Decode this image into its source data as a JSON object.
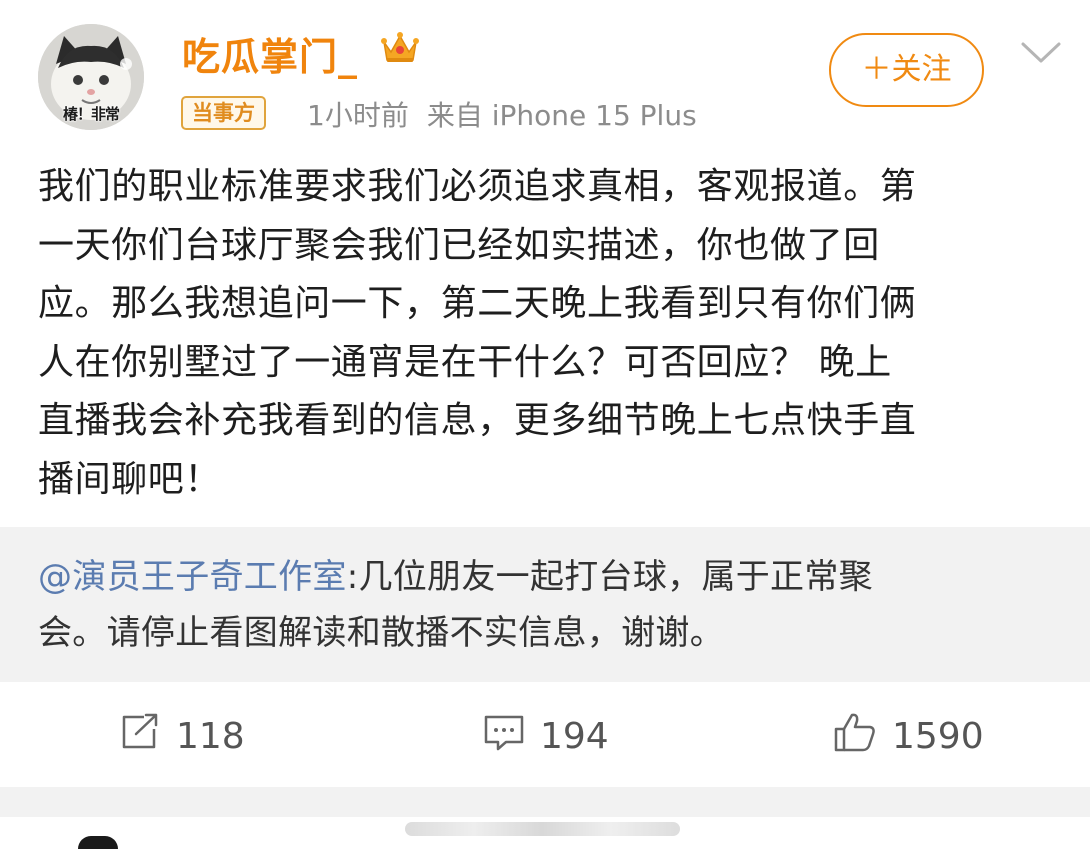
{
  "author": {
    "name": "吃瓜掌门_",
    "avatar_caption": "椿！非常",
    "badge": "当事方",
    "time": "1小时前",
    "source": "来自 iPhone 15 Plus",
    "verified_icon": "crown-icon"
  },
  "follow_button": "＋关注",
  "post": {
    "lines": [
      "我们的职业标准要求我们必须追求真相，客观报道。第",
      "一天你们台球厅聚会我们已经如实描述，你也做了回",
      "应。那么我想追问一下，第二天晚上我看到只有你们俩",
      "人在你别墅过了一通宵是在干什么？可否回应？ 晚上",
      "直播我会补充我看到的信息，更多细节晚上七点快手直",
      "播间聊吧！"
    ]
  },
  "repost": {
    "mention": "@演员王子奇工作室",
    "line1_rest": ":几位朋友一起打台球，属于正常聚",
    "line2": "会。请停止看图解读和散播不实信息，谢谢。"
  },
  "actions": {
    "share_count": "118",
    "comment_count": "194",
    "like_count": "1590"
  },
  "colors": {
    "accent": "#f08a12",
    "mention": "#5b7cb0",
    "repost_bg": "#f2f2f2"
  }
}
